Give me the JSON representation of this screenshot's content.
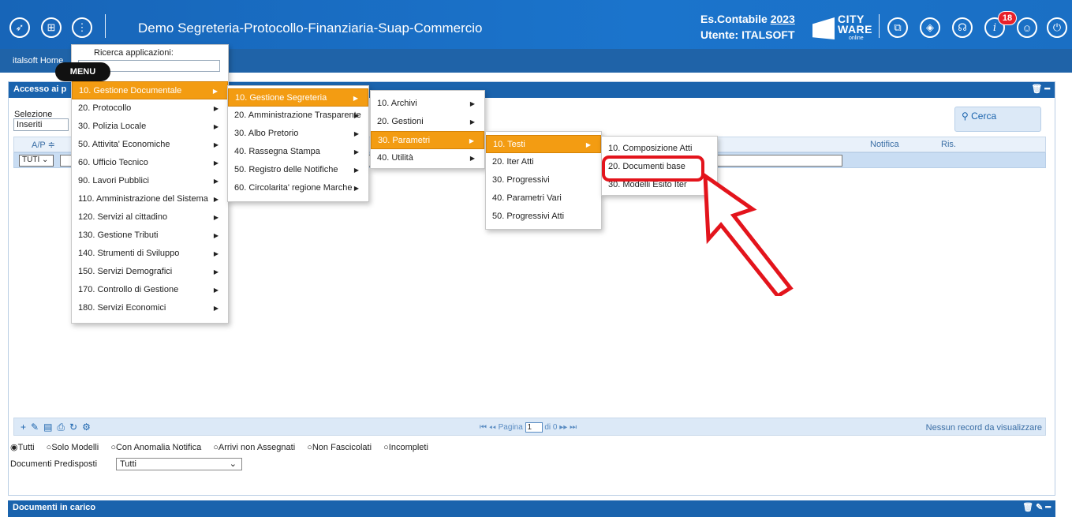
{
  "header": {
    "title": "Demo Segreteria-Protocollo-Finanziaria-Suap-Commercio",
    "exercise_label": "Es.Contabile",
    "exercise_year": "2023",
    "user_label": "Utente: ITALSOFT",
    "logo_text": "CITY\nWARE",
    "logo_sub": "online",
    "notification_count": "18",
    "left_icons": [
      "rocket-icon",
      "apps-grid-icon",
      "more-vertical-icon"
    ],
    "right_icons": [
      "windows-icon",
      "layers-icon",
      "headset-icon",
      "info-icon",
      "user-icon",
      "power-icon"
    ]
  },
  "subbar": {
    "home": "italsoft Home",
    "menu_tooltip": "MENU"
  },
  "panel": {
    "title": "Accesso ai p",
    "selezione_label": "Selezione",
    "selezione_value": "Inseriti",
    "search_label": "Cerca",
    "columns": {
      "ap": "A/P ≑",
      "notifica": "Notifica",
      "ris": "Ris."
    },
    "filter_value": "TUTI",
    "pager": {
      "page_label": "Pagina",
      "page_value": "1",
      "of_label": "di 0"
    },
    "no_records": "Nessun record da visualizzare",
    "radios": [
      "Tutti",
      "Solo Modelli",
      "Con Anomalia Notifica",
      "Arrivi non Assegnati",
      "Non Fascicolati",
      "Incompleti"
    ],
    "doc_predisposti_label": "Documenti Predisposti",
    "doc_predisposti_value": "Tutti"
  },
  "panel2": {
    "title": "Documenti in carico"
  },
  "menu1": {
    "search_label": "Ricerca applicazioni:",
    "items": [
      "10. Gestione Documentale",
      "20. Protocollo",
      "30. Polizia Locale",
      "50. Attivita' Economiche",
      "60. Ufficio Tecnico",
      "90. Lavori Pubblici",
      "110. Amministrazione del Sistema",
      "120. Servizi al cittadino",
      "130. Gestione Tributi",
      "140. Strumenti di Sviluppo",
      "150. Servizi Demografici",
      "170. Controllo di Gestione",
      "180. Servizi Economici"
    ]
  },
  "menu2": {
    "items": [
      "10. Gestione Segreteria",
      "20. Amministrazione Trasparente",
      "30. Albo Pretorio",
      "40. Rassegna Stampa",
      "50. Registro delle Notifiche",
      "60. Circolarita' regione Marche"
    ]
  },
  "menu3": {
    "items": [
      "10. Archivi",
      "20. Gestioni",
      "30. Parametri",
      "40. Utilità"
    ]
  },
  "menu4": {
    "items": [
      "10. Testi",
      "20. Iter Atti",
      "30. Progressivi",
      "40. Parametri Vari",
      "50. Progressivi Atti"
    ]
  },
  "menu5": {
    "items": [
      "10. Composizione Atti",
      "20. Documenti base",
      "30. Modelli Esito Iter"
    ]
  },
  "colors": {
    "header_blue": "#1a6fc4",
    "active_orange": "#f39c12",
    "highlight_red": "#e3141c"
  }
}
